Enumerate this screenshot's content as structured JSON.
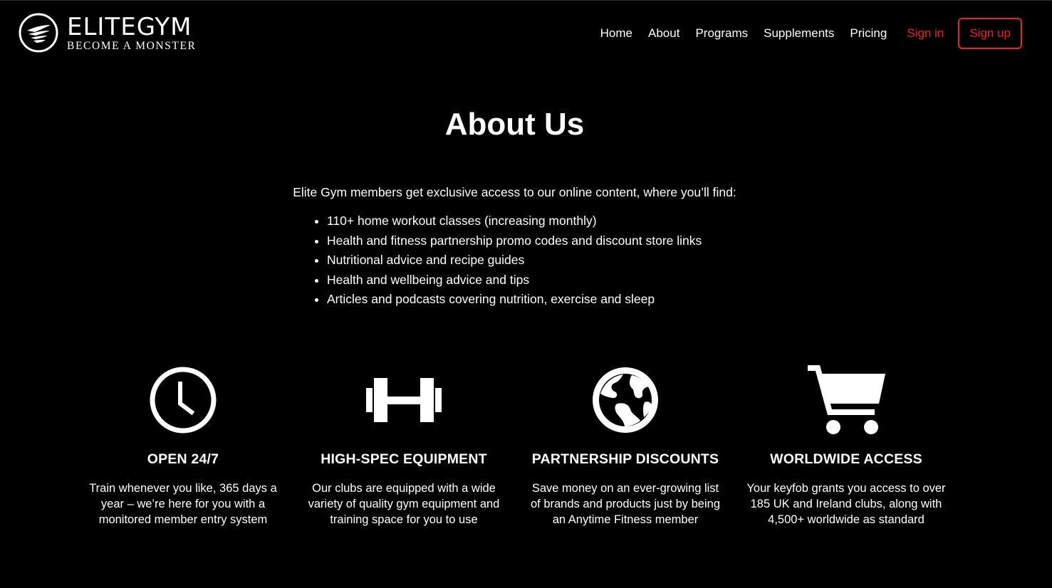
{
  "brand": {
    "name": "ELITEGYM",
    "tagline": "BECOME A MONSTER"
  },
  "nav": {
    "items": [
      {
        "label": "Home"
      },
      {
        "label": "About"
      },
      {
        "label": "Programs"
      },
      {
        "label": "Supplements"
      },
      {
        "label": "Pricing"
      }
    ],
    "signin_label": "Sign in",
    "signup_label": "Sign up"
  },
  "about": {
    "title": "About Us",
    "intro": "Elite Gym members get exclusive access to our online content, where you’ll find:",
    "list": [
      "110+ home workout classes (increasing monthly)",
      "Health and fitness partnership promo codes and discount store links",
      "Nutritional advice and recipe guides",
      "Health and wellbeing advice and tips",
      "Articles and podcasts covering nutrition, exercise and sleep"
    ]
  },
  "features": [
    {
      "icon": "clock-icon",
      "title": "OPEN 24/7",
      "text": "Train whenever you like, 365 days a year – we’re here for you with a monitored member entry system"
    },
    {
      "icon": "dumbbell-icon",
      "title": "HIGH-SPEC EQUIPMENT",
      "text": "Our clubs are equipped with a wide variety of quality gym equipment and training space for you to use"
    },
    {
      "icon": "globe-icon",
      "title": "PARTNERSHIP DISCOUNTS",
      "text": "Save money on an ever-growing list of brands and products just by being an Anytime Fitness member"
    },
    {
      "icon": "cart-icon",
      "title": "WORLDWIDE ACCESS",
      "text": "Your keyfob grants you access to over 185 UK and Ireland clubs, along with 4,500+ worldwide as standard"
    }
  ],
  "colors": {
    "background": "#000000",
    "text": "#ffffff",
    "accent": "#e8232a"
  }
}
